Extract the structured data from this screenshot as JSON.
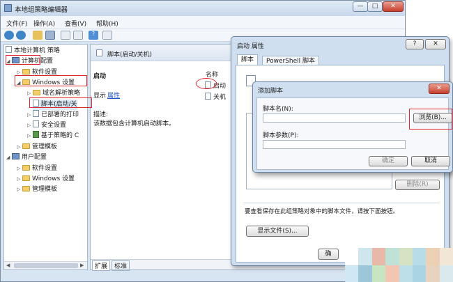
{
  "window": {
    "title": "本地组策略编辑器"
  },
  "menu": [
    "文件(F)",
    "操作(A)",
    "查看(V)",
    "帮助(H)"
  ],
  "tree": {
    "root": "本地计算机 策略",
    "computer_config": "计算机配置",
    "software_settings": "软件设置",
    "windows_settings": "Windows 设置",
    "dns_policy": "域名解析策略",
    "scripts": "脚本(启动/关",
    "deployed_printers": "已部署的打印",
    "security_settings": "安全设置",
    "qos_policy": "基于策略的 C",
    "admin_templates": "管理模板",
    "user_config": "用户配置",
    "user_software": "软件设置",
    "user_windows": "Windows 设置",
    "user_admin": "管理模板"
  },
  "content": {
    "header": "脚本(启动/关机)",
    "section_title": "启动",
    "show_label": "显示",
    "properties_link": "属性",
    "desc_label": "描述:",
    "desc_text": "该数据包含计算机启动脚本。",
    "col_name": "名称",
    "item_startup": "启动",
    "item_shutdown": "关机",
    "tab_extended": "扩展",
    "tab_standard": "标准"
  },
  "props_dialog": {
    "title": "启动 属性",
    "help": "?",
    "close": "✕",
    "tab_scripts": "脚本",
    "tab_powershell": "PowerShell 脚本",
    "remove_button": "删除(R)",
    "info_text": "要查看保存在此组策略对象中的脚本文件，请按下面按钮。",
    "show_files_button": "显示文件(S)...",
    "ok_button_partial": "确"
  },
  "add_dialog": {
    "title": "添加脚本",
    "close": "✕",
    "script_name_label": "脚本名(N):",
    "script_name_value": "",
    "script_params_label": "脚本参数(P):",
    "script_params_value": "",
    "browse_button": "浏览(B)...",
    "ok_button": "确定",
    "cancel_button": "取消"
  },
  "colors": {
    "highlight": "#e0262c",
    "link": "#1a56c4",
    "window_frame": "#cfdff0"
  }
}
